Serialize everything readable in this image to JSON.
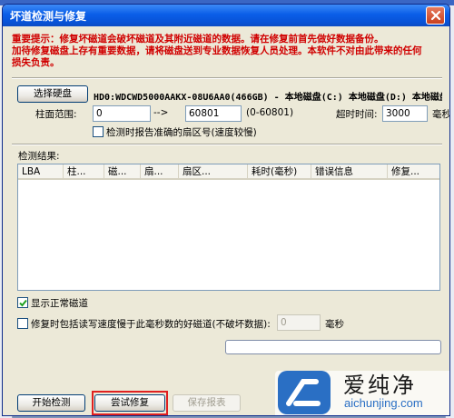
{
  "background": {
    "marks": [
      "info",
      "info",
      "info"
    ]
  },
  "window": {
    "title": "坏道检测与修复"
  },
  "warning": {
    "line1": "重要提示：修复坏磁道会破坏磁道及其附近磁道的数据。请在修复前首先做好数据备份。",
    "line2": "加待修复磁盘上存有重要数据，请将磁盘送到专业数据恢复人员处理。本软件不对由此带来的任何",
    "line3": "损失负责。"
  },
  "disk": {
    "select_button": "选择硬盘",
    "drive_info": "HD0:WDCWD5000AAKX-08U6AA0(466GB) - 本地磁盘(C:) 本地磁盘(D:) 本地磁盘"
  },
  "range": {
    "label": "柱面范围:",
    "start": "0",
    "arrow": "-->",
    "end": "60801",
    "hint": "(0-60801)",
    "timeout_label": "超时时间:",
    "timeout_value": "3000",
    "timeout_unit": "毫秒",
    "report_sector_label": "检测时报告准确的扇区号(速度较慢)"
  },
  "results": {
    "label": "检测结果:",
    "columns": [
      "LBA",
      "柱...",
      "磁...",
      "扇...",
      "扇区...",
      "耗时(毫秒)",
      "错误信息",
      "修复..."
    ]
  },
  "options": {
    "show_normal_label": "显示正常磁道",
    "include_slow_label": "修复时包括读写速度慢于此毫秒数的好磁道(不破坏数据):",
    "slow_value": "0",
    "slow_unit": "毫秒"
  },
  "progress": {
    "value": 0
  },
  "buttons": {
    "start": "开始检测",
    "repair": "尝试修复",
    "save": "保存报表"
  },
  "watermark": {
    "brand_cn": "爱纯净",
    "brand_en": "aichunjing.com"
  },
  "colors": {
    "title_bar": "#0a5ee8",
    "warning_text": "#d00000",
    "highlight": "#e02020",
    "dialog_bg": "#ece9d8"
  }
}
